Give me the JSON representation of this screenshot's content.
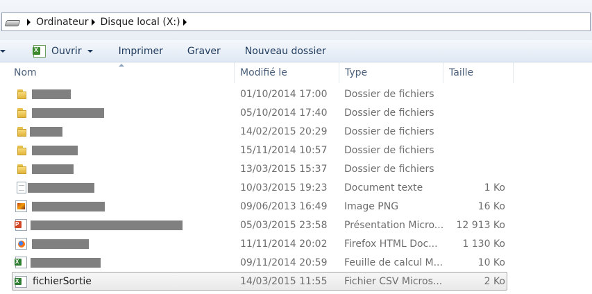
{
  "address_bar": {
    "drive_icon": "drive-icon",
    "crumbs": [
      "Ordinateur",
      "Disque local (X:)"
    ]
  },
  "toolbar": {
    "open_label": "Ouvrir",
    "print_label": "Imprimer",
    "burn_label": "Graver",
    "new_folder_label": "Nouveau dossier"
  },
  "columns": {
    "name": "Nom",
    "modified": "Modifié le",
    "type": "Type",
    "size": "Taille"
  },
  "files": [
    {
      "name": "",
      "redacted": true,
      "icon": "folder-icon",
      "modified": "01/10/2014 17:00",
      "type": "Dossier de fichiers",
      "size": ""
    },
    {
      "name": "",
      "redacted": true,
      "icon": "folder-icon",
      "modified": "05/10/2014 17:40",
      "type": "Dossier de fichiers",
      "size": ""
    },
    {
      "name": "",
      "redacted": true,
      "icon": "folder-icon",
      "modified": "14/02/2015 20:29",
      "type": "Dossier de fichiers",
      "size": ""
    },
    {
      "name": "",
      "redacted": true,
      "icon": "folder-icon",
      "modified": "15/11/2014 10:57",
      "type": "Dossier de fichiers",
      "size": ""
    },
    {
      "name": "",
      "redacted": true,
      "icon": "folder-icon",
      "modified": "13/03/2015 15:37",
      "type": "Dossier de fichiers",
      "size": ""
    },
    {
      "name": "",
      "redacted": true,
      "icon": "text-document-icon",
      "modified": "10/03/2015 19:23",
      "type": "Document texte",
      "size": "1 Ko"
    },
    {
      "name": "",
      "redacted": true,
      "icon": "png-image-icon",
      "modified": "09/06/2013 16:49",
      "type": "Image PNG",
      "size": "16 Ko"
    },
    {
      "name": "",
      "redacted": true,
      "icon": "powerpoint-icon",
      "modified": "05/03/2015 23:58",
      "type": "Présentation Micro...",
      "size": "12 913 Ko"
    },
    {
      "name": "",
      "redacted": true,
      "icon": "firefox-html-icon",
      "modified": "11/11/2014 20:02",
      "type": "Firefox HTML Doc...",
      "size": "1 130 Ko"
    },
    {
      "name": "",
      "redacted": true,
      "icon": "excel-icon",
      "modified": "09/11/2014 20:59",
      "type": "Feuille de calcul M...",
      "size": "10 Ko"
    },
    {
      "name": "fichierSortie",
      "redacted": false,
      "icon": "csv-file-icon",
      "modified": "14/03/2015 11:55",
      "type": "Fichier CSV Micros...",
      "size": "2 Ko",
      "selected": true
    }
  ]
}
